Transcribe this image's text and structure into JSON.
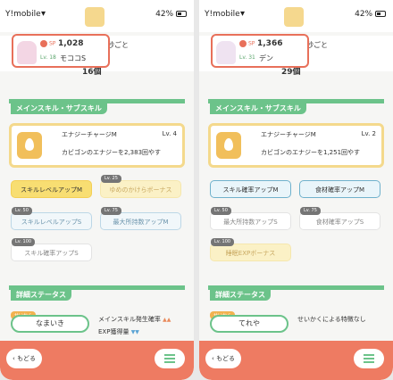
{
  "status": {
    "carrier": "Y!mobile",
    "battery": "42%"
  },
  "panels": [
    {
      "peek_value": "16個",
      "peek_text": "秒ごと",
      "mon": {
        "sp_label": "SP",
        "sp": "1,028",
        "level": "Lv. 18",
        "name": "モココS"
      },
      "section_skill": "メインスキル・サブスキル",
      "skill": {
        "name": "エナジーチャージM",
        "level": "Lv. 4",
        "desc": "カビゴンのエナジーを2,383回やす"
      },
      "subs": [
        {
          "label": "スキルレベルアップM",
          "lv": ""
        },
        {
          "label": "ゆめのかけらボーナス",
          "lv": "Lv. 25"
        },
        {
          "label": "スキルレベルアップS",
          "lv": "Lv. 50"
        },
        {
          "label": "最大所持数アップM",
          "lv": "Lv. 75"
        },
        {
          "label": "スキル確率アップS",
          "lv": "Lv. 100"
        }
      ],
      "section_stat": "詳細ステータス",
      "nature_tag": "せいかく",
      "nature": "なまいき",
      "nat_line1": "メインスキル発生確率",
      "nat_line1_mark": "▲▲",
      "nat_line2": "EXP獲得量",
      "nat_line2_mark": "▼▼",
      "back": "もどる"
    },
    {
      "peek_value": "29個",
      "peek_text": "秒ごと",
      "mon": {
        "sp_label": "SP",
        "sp": "1,366",
        "level": "Lv. 31",
        "name": "デン"
      },
      "section_skill": "メインスキル・サブスキル",
      "skill": {
        "name": "エナジーチャージM",
        "level": "Lv. 2",
        "desc": "カビゴンのエナジーを1,251回やす"
      },
      "subs": [
        {
          "label": "スキル確率アップM",
          "lv": ""
        },
        {
          "label": "食材確率アップM",
          "lv": ""
        },
        {
          "label": "最大所持数アップS",
          "lv": "Lv. 50"
        },
        {
          "label": "食材確率アップS",
          "lv": "Lv. 75"
        },
        {
          "label": "睡眠EXPボーナス",
          "lv": "Lv. 100"
        }
      ],
      "section_stat": "詳細ステータス",
      "nature_tag": "せいかく",
      "nature": "てれや",
      "nat_line1": "せいかくによる特徴なし",
      "nat_line1_mark": "",
      "nat_line2": "",
      "nat_line2_mark": "",
      "back": "もどる"
    }
  ]
}
